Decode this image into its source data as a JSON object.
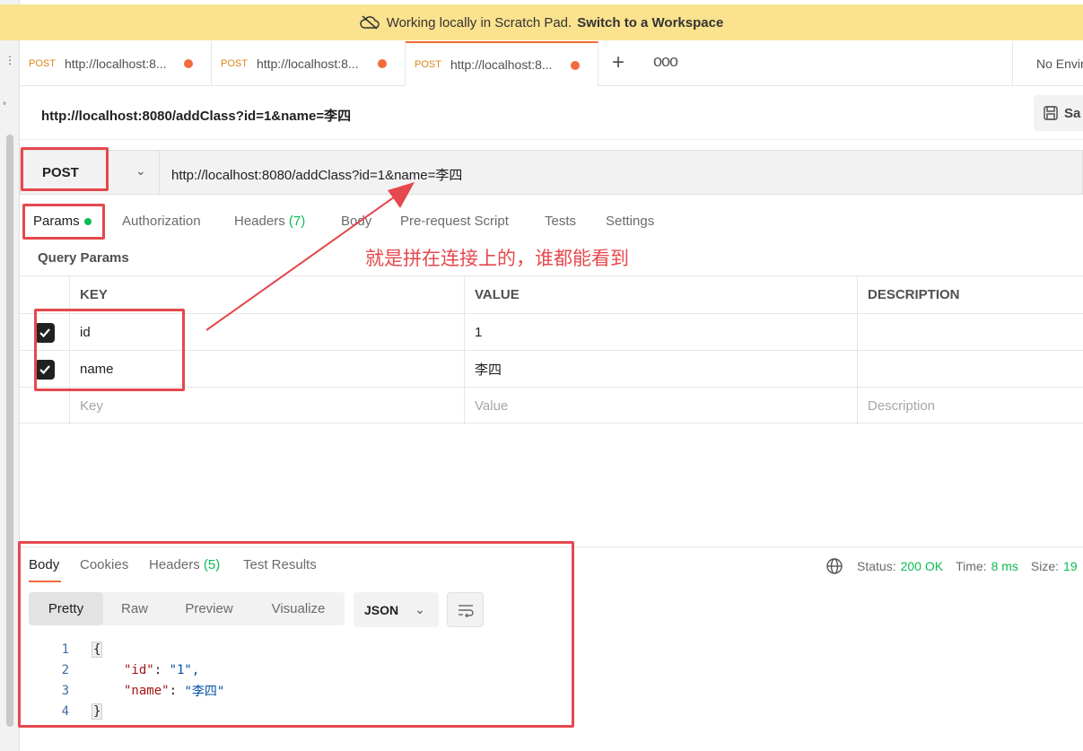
{
  "banner": {
    "text": "Working locally in Scratch Pad.",
    "link": "Switch to a Workspace"
  },
  "tabs": [
    {
      "method": "POST",
      "title": "http://localhost:8..."
    },
    {
      "method": "POST",
      "title": "http://localhost:8..."
    },
    {
      "method": "POST",
      "title": "http://localhost:8..."
    }
  ],
  "environment": "No Envir",
  "request": {
    "title": "http://localhost:8080/addClass?id=1&name=李四",
    "save_label": "Sa",
    "method": "POST",
    "url": "http://localhost:8080/addClass?id=1&name=李四"
  },
  "request_tabs": {
    "params": "Params",
    "authorization": "Authorization",
    "headers": "Headers",
    "headers_count": "(7)",
    "body": "Body",
    "prerequest": "Pre-request Script",
    "tests": "Tests",
    "settings": "Settings"
  },
  "query_params": {
    "label": "Query Params",
    "headers": {
      "key": "KEY",
      "value": "VALUE",
      "description": "DESCRIPTION"
    },
    "rows": [
      {
        "key": "id",
        "value": "1",
        "description": ""
      },
      {
        "key": "name",
        "value": "李四",
        "description": ""
      }
    ],
    "placeholders": {
      "key": "Key",
      "value": "Value",
      "description": "Description"
    }
  },
  "annotation": "就是拼在连接上的，谁都能看到",
  "response": {
    "tabs": {
      "body": "Body",
      "cookies": "Cookies",
      "headers": "Headers",
      "headers_count": "(5)",
      "test_results": "Test Results"
    },
    "status_label": "Status:",
    "status_value": "200 OK",
    "time_label": "Time:",
    "time_value": "8 ms",
    "size_label": "Size:",
    "size_value": "19",
    "views": [
      "Pretty",
      "Raw",
      "Preview",
      "Visualize"
    ],
    "format": "JSON",
    "code_lines": [
      {
        "n": "1"
      },
      {
        "n": "2",
        "key": "\"id\"",
        "val": "\"1\","
      },
      {
        "n": "3",
        "key": "\"name\"",
        "val": "\"李四\""
      },
      {
        "n": "4"
      }
    ],
    "brace_open": "{",
    "brace_close": "}",
    "colon": ": "
  },
  "colors": {
    "accent": "#f26b3a",
    "green": "#0cbb52",
    "annotation_red": "#e5484d",
    "banner": "#fae28e"
  }
}
